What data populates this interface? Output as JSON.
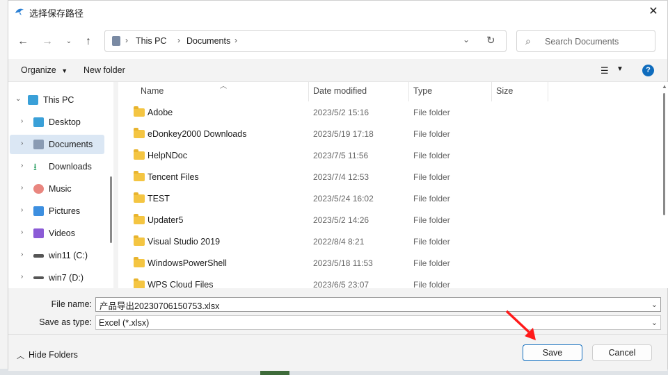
{
  "window": {
    "title": "选择保存路径"
  },
  "address": {
    "crumbs": [
      "This PC",
      "Documents"
    ]
  },
  "search": {
    "placeholder": "Search Documents"
  },
  "toolbar": {
    "organize": "Organize",
    "new_folder": "New folder"
  },
  "sidebar": {
    "items": [
      {
        "label": "This PC",
        "icon": "monitor-icon"
      },
      {
        "label": "Desktop",
        "icon": "desktop-icon"
      },
      {
        "label": "Documents",
        "icon": "documents-icon"
      },
      {
        "label": "Downloads",
        "icon": "download-icon"
      },
      {
        "label": "Music",
        "icon": "music-icon"
      },
      {
        "label": "Pictures",
        "icon": "pictures-icon"
      },
      {
        "label": "Videos",
        "icon": "videos-icon"
      },
      {
        "label": "win11 (C:)",
        "icon": "drive-icon"
      },
      {
        "label": "win7 (D:)",
        "icon": "drive-icon"
      }
    ]
  },
  "columns": {
    "name": "Name",
    "date": "Date modified",
    "type": "Type",
    "size": "Size"
  },
  "files": [
    {
      "name": "Adobe",
      "date": "2023/5/2 15:16",
      "type": "File folder"
    },
    {
      "name": "eDonkey2000 Downloads",
      "date": "2023/5/19 17:18",
      "type": "File folder"
    },
    {
      "name": "HelpNDoc",
      "date": "2023/7/5 11:56",
      "type": "File folder"
    },
    {
      "name": "Tencent Files",
      "date": "2023/7/4 12:53",
      "type": "File folder"
    },
    {
      "name": "TEST",
      "date": "2023/5/24 16:02",
      "type": "File folder"
    },
    {
      "name": "Updater5",
      "date": "2023/5/2 14:26",
      "type": "File folder"
    },
    {
      "name": "Visual Studio 2019",
      "date": "2022/8/4 8:21",
      "type": "File folder"
    },
    {
      "name": "WindowsPowerShell",
      "date": "2023/5/18 11:53",
      "type": "File folder"
    },
    {
      "name": "WPS Cloud Files",
      "date": "2023/6/5 23:07",
      "type": "File folder"
    }
  ],
  "form": {
    "file_name_label": "File name:",
    "file_name_value": "产品导出20230706150753.xlsx",
    "save_type_label": "Save as type:",
    "save_type_value": "Excel (*.xlsx)"
  },
  "footer": {
    "hide_folders": "Hide Folders",
    "save": "Save",
    "cancel": "Cancel"
  },
  "colors": {
    "accent": "#0f6cbd",
    "folder": "#f4c542",
    "selected": "#dbe7f4",
    "arrow": "#ff1a1a"
  }
}
